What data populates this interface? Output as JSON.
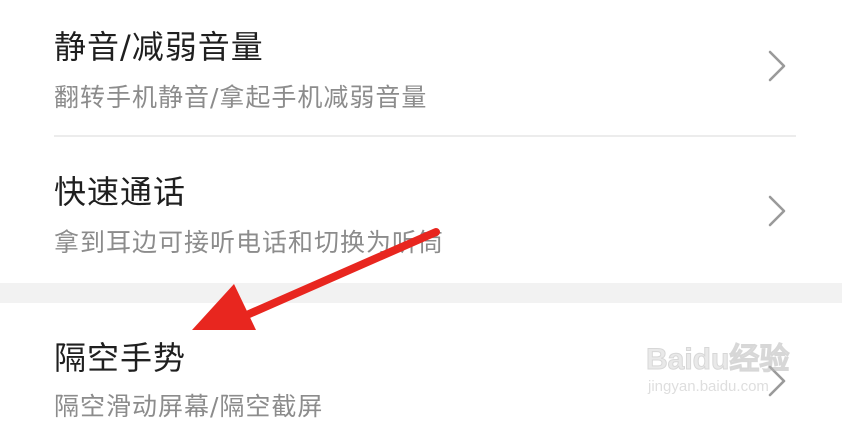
{
  "settings": {
    "items": [
      {
        "title": "静音/减弱音量",
        "subtitle": "翻转手机静音/拿起手机减弱音量"
      },
      {
        "title": "快速通话",
        "subtitle": "拿到耳边可接听电话和切换为听筒"
      },
      {
        "title": "隔空手势",
        "subtitle": "隔空滑动屏幕/隔空截屏"
      }
    ]
  },
  "watermark": {
    "logo_text": "Baidu经验",
    "url_text": "jingyan.baidu.com"
  },
  "colors": {
    "arrow": "#e8261f",
    "title": "#1f1f1f",
    "subtitle": "#8c8c8c",
    "chevron": "#9a9a9a"
  }
}
